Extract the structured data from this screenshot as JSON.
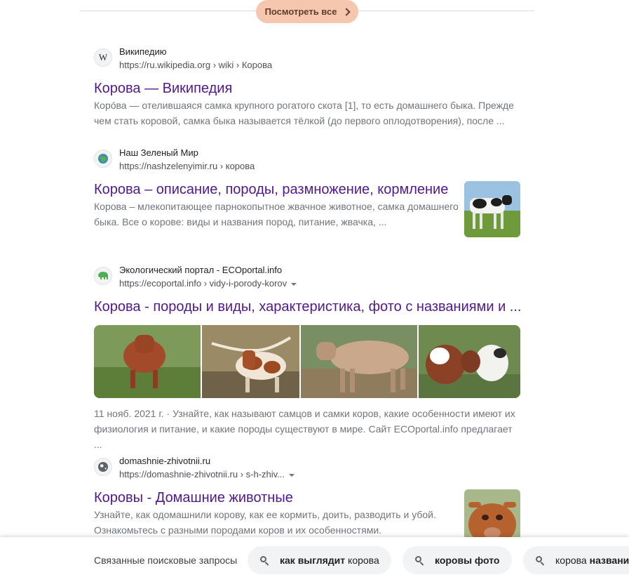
{
  "top": {
    "see_all": "Посмотреть все"
  },
  "results": [
    {
      "site_name": "Википедию",
      "url_host": "https://ru.wikipedia.org",
      "url_path": " › wiki › Корова",
      "title": "Корова — Википедия",
      "snippet_1": "Коро́ва — отелившаяся самка крупного рогатого скота [1], то есть домашнего быка. Прежде",
      "snippet_2": "чем стать коровой, самка быка называется тёлкой (до первого оплодотворения), после ...",
      "favicon": "W"
    },
    {
      "site_name": "Наш Зеленый Мир",
      "url_host": "https://nashzelenyimir.ru",
      "url_path": " › корова",
      "title": "Корова – описание, породы, размножение, кормление",
      "snippet_1": "Корова – млекопитающее парнокопытное жвачное животное, самка домашнего",
      "snippet_2": "быка. Все о корове: виды и названия пород, питание, жвачка, ..."
    },
    {
      "site_name": "Экологический портал - ECOportal.info",
      "url_host": "https://ecoportal.info",
      "url_path": " › vidy-i-porody-korov",
      "title": "Корова - породы и виды, характеристика, фото с названиями и ...",
      "snippet_1": "11 нояб. 2021 г. · Узнайте, как называют самцов и самки коров, какие особенности имеют их",
      "snippet_2": "физиология и питание, и какие породы существуют в мире. Сайт ECOportal.info предлагает ..."
    },
    {
      "site_name": "domashnie-zhivotnii.ru",
      "url_host": "https://domashnie-zhivotnii.ru",
      "url_path": " › s-h-zhiv...",
      "title": "Коровы - Домашние животные",
      "snippet_1": "Узнайте, как одомашнили корову, как ее кормить, доить, разводить и убой.",
      "snippet_2": "Ознакомьтесь с разными породами коров и их особенностями."
    }
  ],
  "related": {
    "label": "Связанные поисковые запросы",
    "chips": [
      {
        "bold": "как выглядит",
        "rest": " корова"
      },
      {
        "bold": "коровы фото",
        "rest": ""
      },
      {
        "plain": "корова ",
        "bold": "названи"
      }
    ]
  },
  "colors": {
    "title_link": "#52188c",
    "see_all_bg": "#f6c7ae",
    "snippet": "#70757a"
  },
  "icons": [
    "wikipedia-icon",
    "globe-leaf-icon",
    "elephant-icon",
    "globe-icon",
    "search-icon",
    "chevron-right-icon",
    "dropdown-arrow-icon"
  ]
}
